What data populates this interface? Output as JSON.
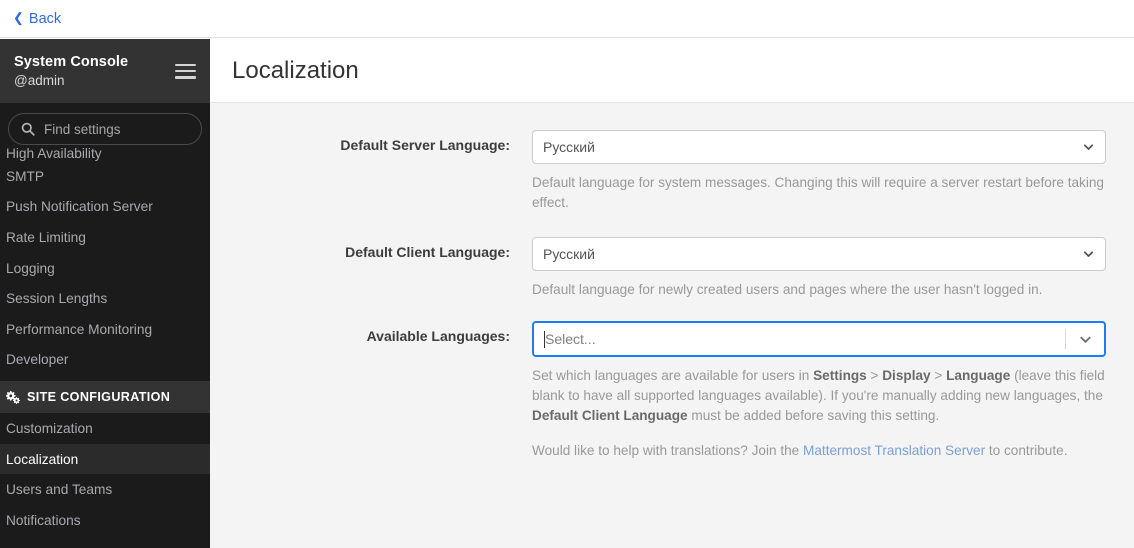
{
  "topbar": {
    "back_label": "Back",
    "back_icon": "chevron-left-icon"
  },
  "sidebar": {
    "title": "System Console",
    "user": "@admin",
    "menu_icon": "hamburger-menu-icon",
    "search": {
      "placeholder": "Find settings",
      "value": "",
      "icon": "search-icon"
    },
    "partial_item": "High Availability",
    "items": [
      {
        "label": "SMTP",
        "active": false
      },
      {
        "label": "Push Notification Server",
        "active": false
      },
      {
        "label": "Rate Limiting",
        "active": false
      },
      {
        "label": "Logging",
        "active": false
      },
      {
        "label": "Session Lengths",
        "active": false
      },
      {
        "label": "Performance Monitoring",
        "active": false
      },
      {
        "label": "Developer",
        "active": false
      }
    ],
    "section": {
      "label": "SITE CONFIGURATION",
      "icon": "gears-icon"
    },
    "section_items": [
      {
        "label": "Customization",
        "active": false
      },
      {
        "label": "Localization",
        "active": true
      },
      {
        "label": "Users and Teams",
        "active": false
      },
      {
        "label": "Notifications",
        "active": false
      }
    ]
  },
  "main": {
    "page_title": "Localization",
    "fields": {
      "server_language": {
        "label": "Default Server Language:",
        "value": "Русский",
        "chevron_icon": "chevron-down-icon",
        "help": "Default language for system messages. Changing this will require a server restart before taking effect."
      },
      "client_language": {
        "label": "Default Client Language:",
        "value": "Русский",
        "chevron_icon": "chevron-down-icon",
        "help": "Default language for newly created users and pages where the user hasn't logged in."
      },
      "available_languages": {
        "label": "Available Languages:",
        "placeholder": "Select...",
        "value": "",
        "chevron_icon": "chevron-down-icon",
        "help_part1": "Set which languages are available for users in ",
        "help_bold1": "Settings",
        "help_sep1": " > ",
        "help_bold2": "Display",
        "help_sep2": " > ",
        "help_bold3": "Language",
        "help_part2": " (leave this field blank to have all supported languages available). If you're manually adding new languages, the ",
        "help_bold4": "Default Client Language",
        "help_part3": " must be added before saving this setting.",
        "translation_part1": "Would like to help with translations? Join the ",
        "translation_link": "Mattermost Translation Server",
        "translation_part2": " to contribute."
      }
    }
  },
  "colors": {
    "sidebar_bg": "#1b1b1b",
    "sidebar_header_bg": "#333333",
    "active_item_bg": "#2b2b2b",
    "link_blue": "#2f6bd8",
    "focus_blue": "#1c7ef2",
    "content_bg": "#f4f4f4",
    "help_text": "#999999"
  }
}
